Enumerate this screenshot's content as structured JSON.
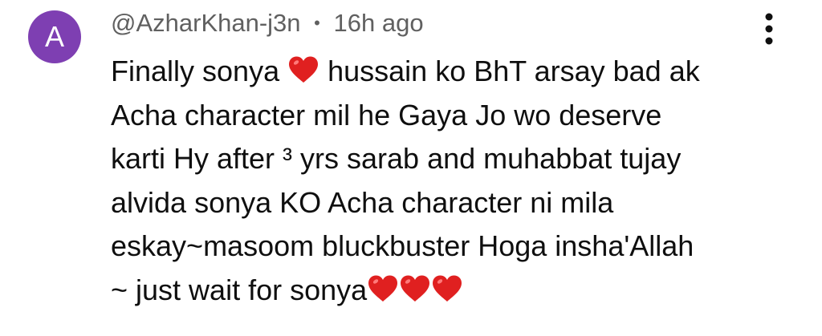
{
  "comment": {
    "avatar_letter": "A",
    "author": "@AzharKhan-j3n",
    "separator": "•",
    "time": "16h ago",
    "lines": [
      [
        "Finally sonya ",
        "heart",
        " hussain ko BhT arsay bad ak"
      ],
      [
        "Acha character mil he Gaya Jo wo deserve"
      ],
      [
        "karti Hy after ³ yrs sarab and muhabbat tujay"
      ],
      [
        "alvida sonya KO Acha character ni mila"
      ],
      [
        "eskay~masoom bluckbuster Hoga insha'Allah"
      ],
      [
        "~ just wait for sonya",
        "heart",
        "heart",
        "heart"
      ]
    ]
  },
  "colors": {
    "avatar_bg": "#7e3fb2",
    "heart": "#e02020",
    "meta_text": "#606060",
    "body_text": "#0f0f0f"
  },
  "icons": {
    "more": "three-dots-vertical-icon",
    "heart": "red-heart-emoji-icon"
  }
}
